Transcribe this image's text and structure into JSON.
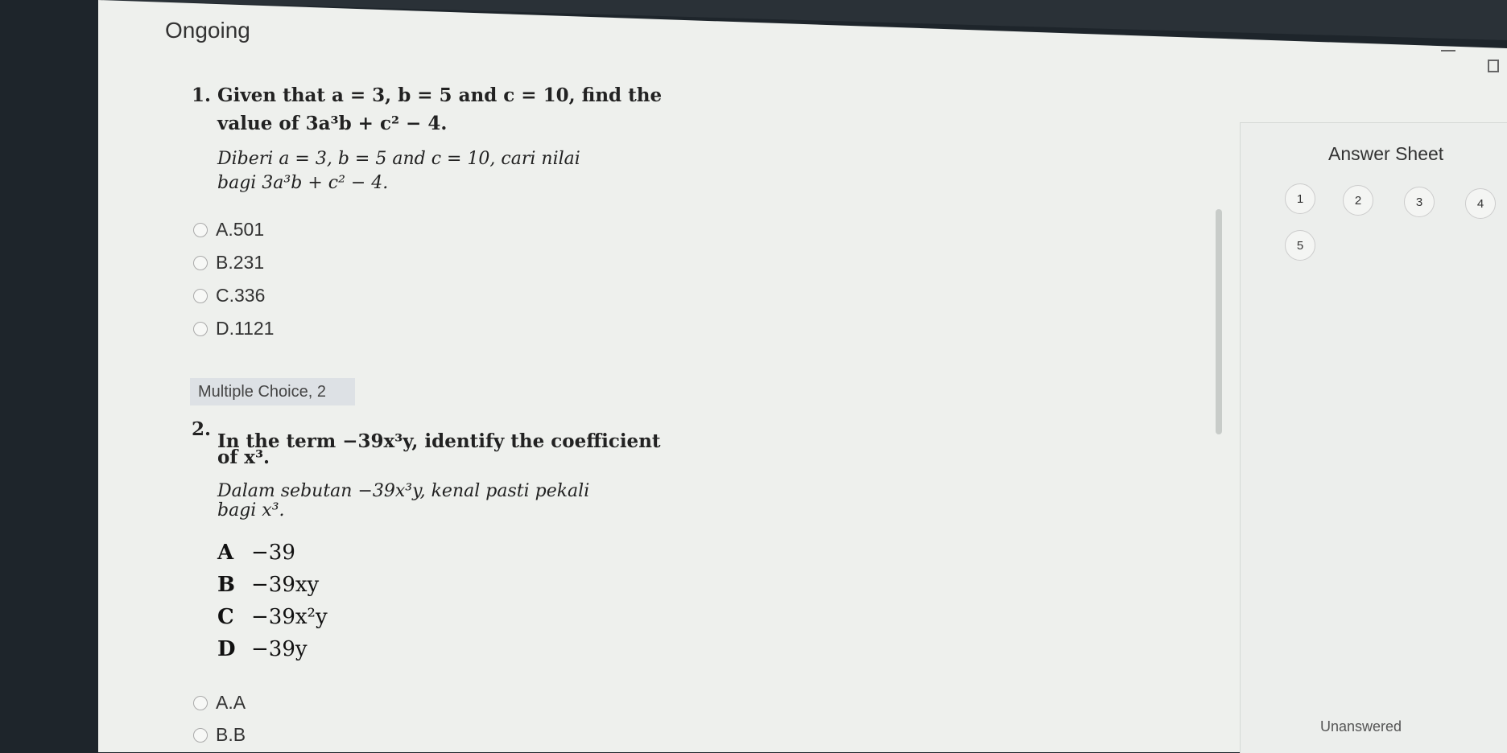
{
  "header": {
    "status": "Ongoing"
  },
  "question1": {
    "number": "1.",
    "text_en_1": "Given that a = 3, b = 5 and c = 10, find the",
    "text_en_2": "value of 3a³b + c² − 4.",
    "text_ms_1": "Diberi a = 3, b = 5 and c = 10, cari nilai",
    "text_ms_2": "bagi 3a³b + c² − 4.",
    "options": [
      "A.501",
      "B.231",
      "C.336",
      "D.1121"
    ]
  },
  "question2": {
    "type_label": "Multiple Choice, 2",
    "number": "2.",
    "text_en_1": "In the term −39x³y, identify the coefficient",
    "text_en_2": "of x³.",
    "text_ms_1": "Dalam sebutan −39x³y, kenal pasti pekali",
    "text_ms_2": "bagi x³.",
    "figure_options": [
      {
        "letter": "A",
        "value": "−39"
      },
      {
        "letter": "B",
        "value": "−39xy"
      },
      {
        "letter": "C",
        "value": "−39x²y"
      },
      {
        "letter": "D",
        "value": "−39y"
      }
    ],
    "options": [
      "A.A",
      "B.B"
    ]
  },
  "answer_sheet": {
    "title": "Answer Sheet",
    "questions": [
      "1",
      "2",
      "3",
      "4",
      "5"
    ],
    "status_label": "Unanswered"
  },
  "icons": [
    "minimize-icon",
    "maximize-icon",
    "radio-icon"
  ]
}
